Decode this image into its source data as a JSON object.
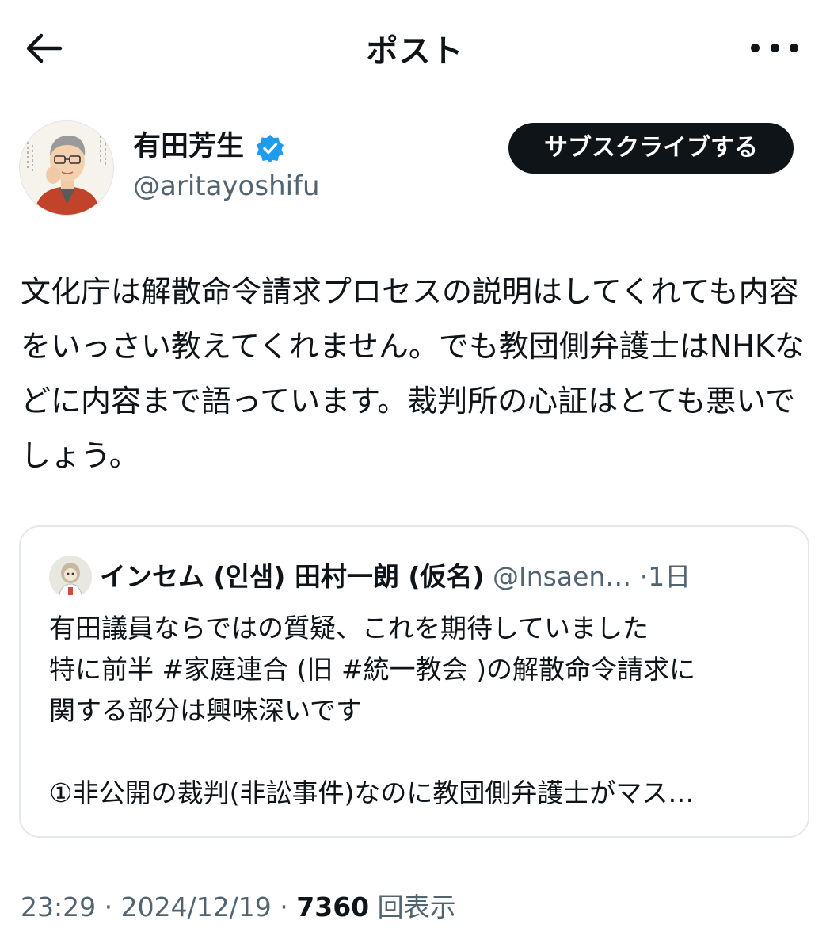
{
  "header": {
    "title": "ポスト"
  },
  "author": {
    "name": "有田芳生",
    "handle": "@aritayoshifu",
    "subscribe_label": "サブスクライブする"
  },
  "post": {
    "text": "文化庁は解散命令請求プロセスの説明はしてくれても内容をいっさい教えてくれません。でも教団側弁護士はNHKなどに内容まで語っています。裁判所の心証はとても悪いでしょう。"
  },
  "quote": {
    "name": "インセム (인샘) 田村一朗 (仮名)",
    "handle": "@Insaen…",
    "separator": "·",
    "time": "1日",
    "lines": [
      "有田議員ならではの質疑、これを期待していました",
      "特に前半 #家庭連合 (旧 #統一教会 )の解散命令請求に",
      "関する部分は興味深いです",
      "",
      "①非公開の裁判(非訟事件)なのに教団側弁護士がマス…"
    ]
  },
  "meta": {
    "time": "23:29",
    "sep1": " · ",
    "date": "2024/12/19",
    "sep2": " · ",
    "views": "7360",
    "views_label": "回表示"
  },
  "colors": {
    "text": "#0f1419",
    "secondary": "#536471",
    "verified": "#1d9bf0",
    "border": "#e4e8ec"
  },
  "icons": {
    "back": "arrow-left-icon",
    "more": "more-horizontal-icon",
    "verified": "verified-badge-icon"
  }
}
